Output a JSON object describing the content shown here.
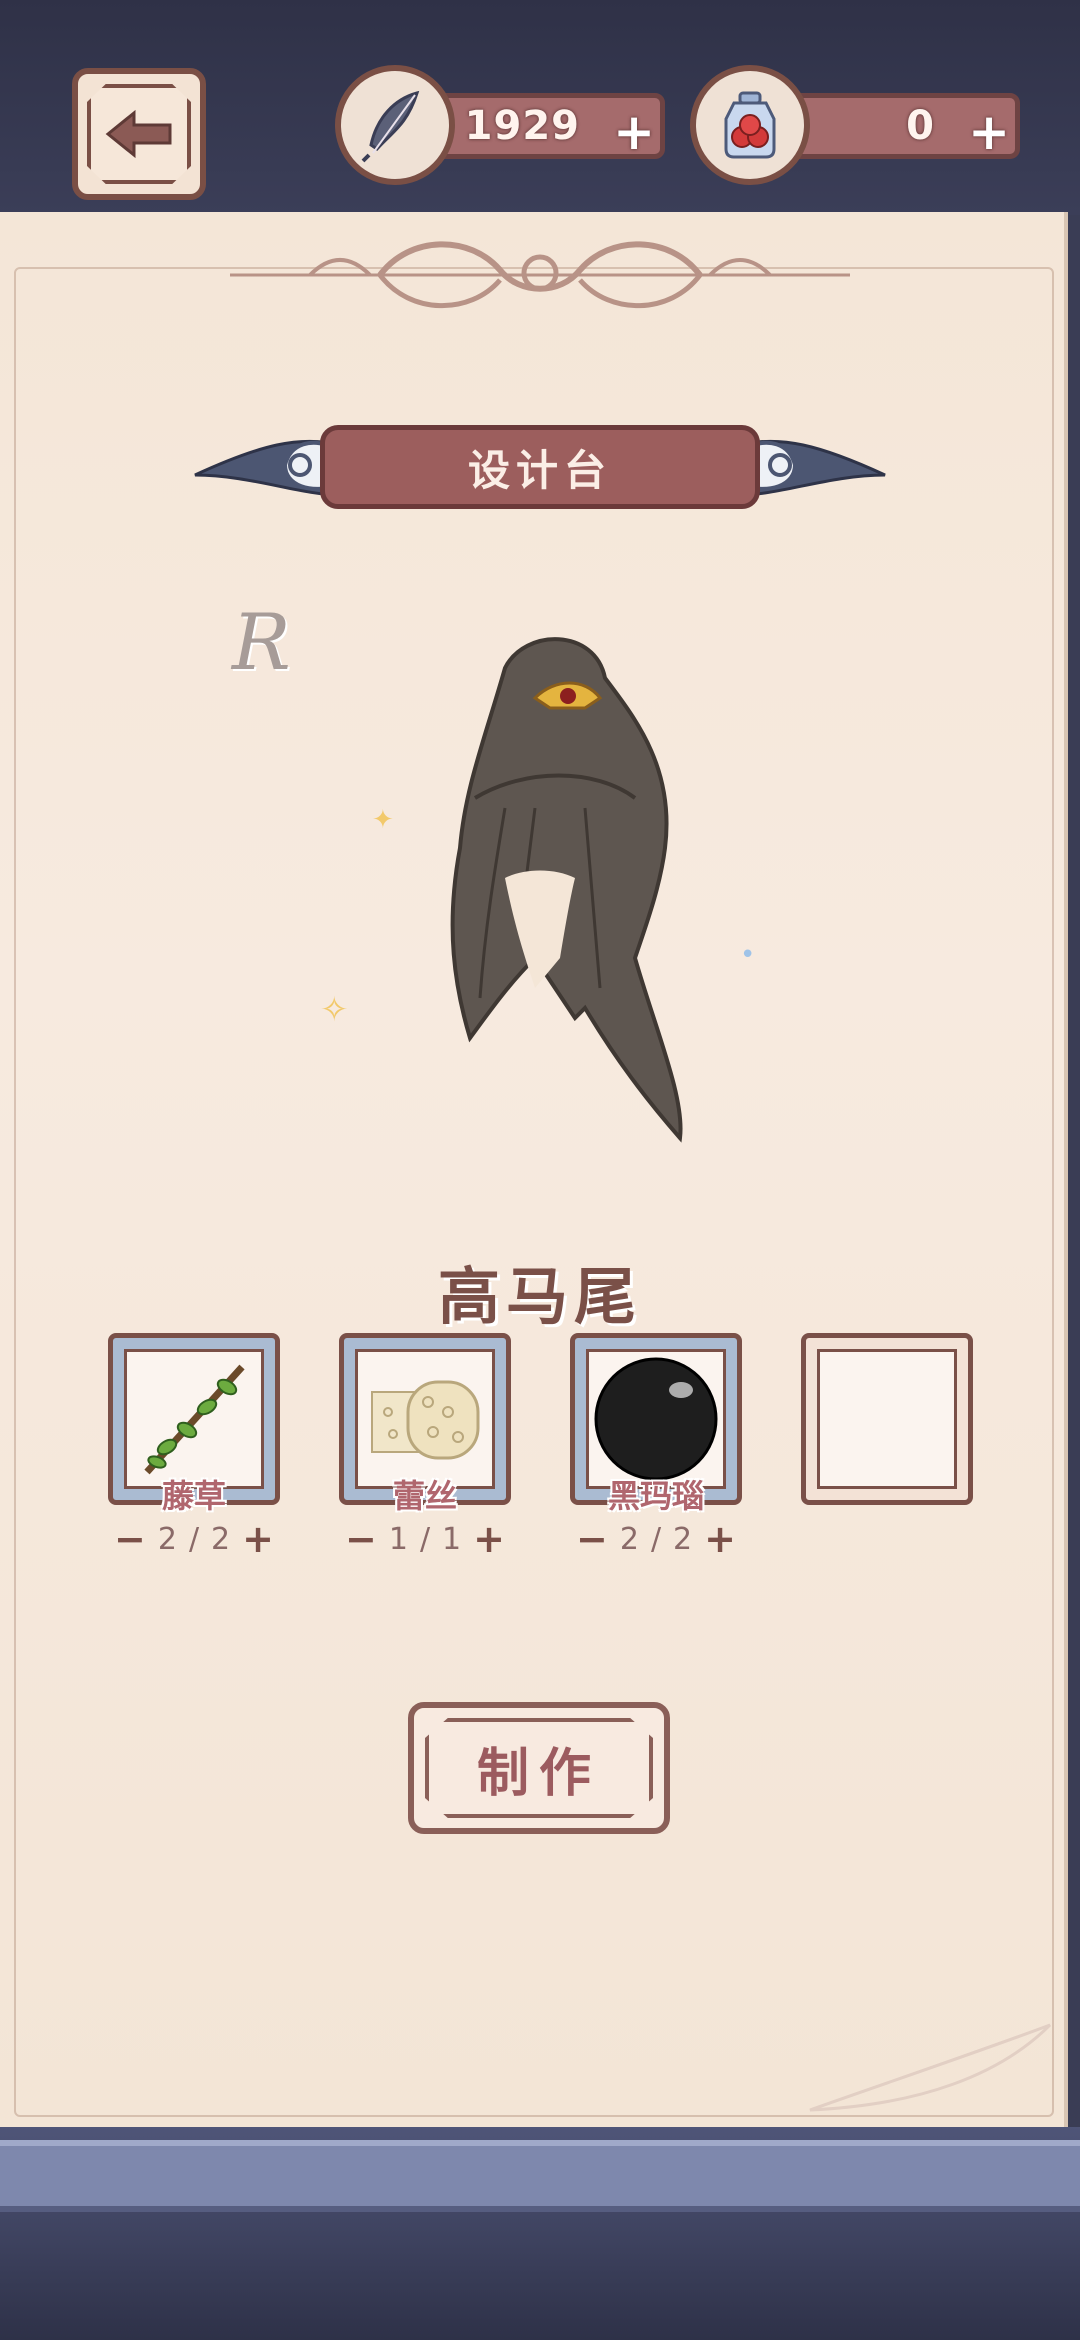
{
  "header": {
    "feather_count": "1929",
    "potion_count": "0",
    "plus_label": "+"
  },
  "panel": {
    "title": "设计台",
    "rarity": "R",
    "item_name": "高马尾"
  },
  "materials": [
    {
      "name": "藤草",
      "owned": "2",
      "required": "2",
      "icon": "vine-icon"
    },
    {
      "name": "蕾丝",
      "owned": "1",
      "required": "1",
      "icon": "lace-icon"
    },
    {
      "name": "黑玛瑙",
      "owned": "2",
      "required": "2",
      "icon": "black-agate-icon"
    }
  ],
  "qty_separator": "/",
  "qty_minus": "−",
  "qty_plus": "+",
  "craft_button": "制作",
  "colors": {
    "accent": "#9c5e5d",
    "border": "#7a5048",
    "paper": "#f4e6d7"
  }
}
